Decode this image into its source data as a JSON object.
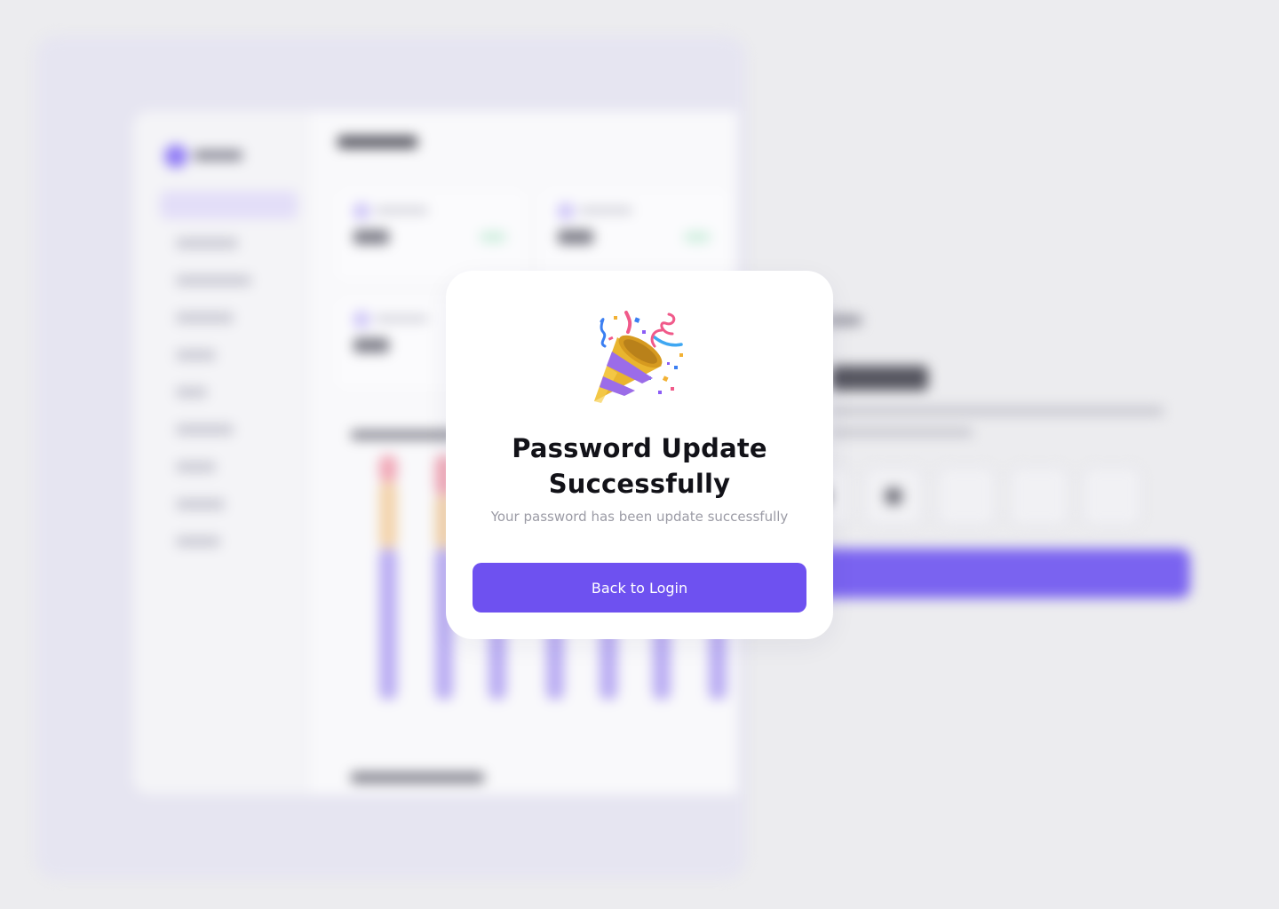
{
  "modal": {
    "icon": "party-popper-icon",
    "title": "Password Update Successfully",
    "subtitle": "Your password has been update successfully",
    "button_label": "Back to Login"
  },
  "colors": {
    "accent": "#6e51f0",
    "modal_background": "#ffffff",
    "page_background": "#ececef",
    "title_text": "#121218",
    "subtitle_text": "#9b9ba5"
  }
}
